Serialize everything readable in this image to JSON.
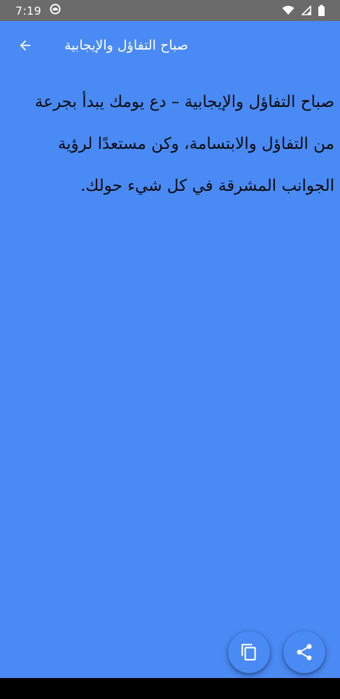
{
  "status_bar": {
    "time": "7:19",
    "icons": [
      "notification-icon",
      "wifi-icon",
      "signal-icon",
      "battery-icon"
    ]
  },
  "app_bar": {
    "title": "صباح التفاؤل والإيجابية",
    "back_icon": "arrow-back-icon"
  },
  "content": {
    "text": "صباح التفاؤل والإيجابية – دع يومك يبدأ بجرعة من التفاؤل والابتسامة، وكن مستعدًا لرؤية الجوانب المشرقة في كل شيء حولك."
  },
  "actions": {
    "copy_icon": "copy-icon",
    "share_icon": "share-icon"
  },
  "colors": {
    "background": "#4A8AF4",
    "status_bar": "#6B6B6B",
    "text": "#0B0B0B"
  }
}
